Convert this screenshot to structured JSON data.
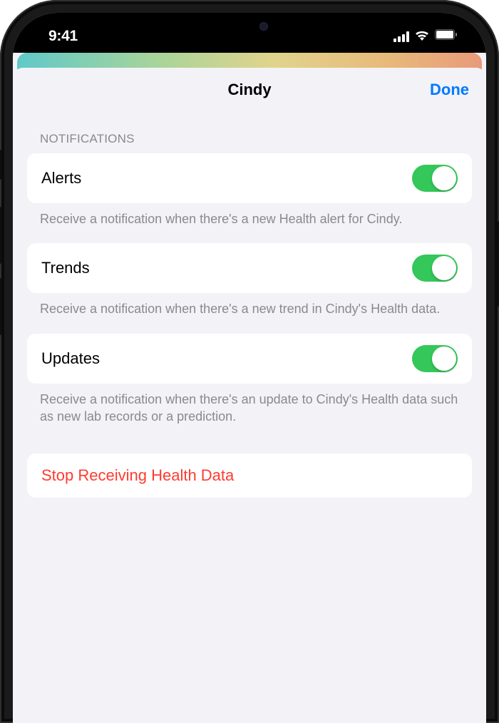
{
  "status_bar": {
    "time": "9:41"
  },
  "nav": {
    "title": "Cindy",
    "done": "Done"
  },
  "section": {
    "header": "NOTIFICATIONS"
  },
  "notifications": {
    "alerts": {
      "label": "Alerts",
      "enabled": true,
      "footer": "Receive a notification when there's a new Health alert for Cindy."
    },
    "trends": {
      "label": "Trends",
      "enabled": true,
      "footer": "Receive a notification when there's a new trend in Cindy's Health data."
    },
    "updates": {
      "label": "Updates",
      "enabled": true,
      "footer": "Receive a notification when there's an update to Cindy's Health data such as new lab records or a prediction."
    }
  },
  "actions": {
    "stop": "Stop Receiving Health Data"
  },
  "colors": {
    "accent": "#007aff",
    "destructive": "#ff3b30",
    "toggle_on": "#34c759"
  }
}
